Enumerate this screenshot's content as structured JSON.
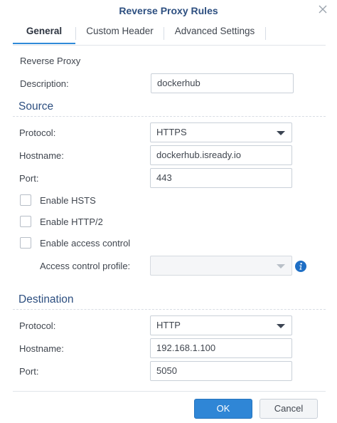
{
  "dialog": {
    "title": "Reverse Proxy Rules"
  },
  "tabs": [
    {
      "label": "General",
      "active": true
    },
    {
      "label": "Custom Header",
      "active": false
    },
    {
      "label": "Advanced Settings",
      "active": false
    }
  ],
  "general": {
    "heading": "Reverse Proxy",
    "description_label": "Description:",
    "description_value": "dockerhub"
  },
  "source": {
    "title": "Source",
    "protocol_label": "Protocol:",
    "protocol_value": "HTTPS",
    "hostname_label": "Hostname:",
    "hostname_value": "dockerhub.isready.io",
    "port_label": "Port:",
    "port_value": "443",
    "hsts_label": "Enable HSTS",
    "hsts_checked": false,
    "http2_label": "Enable HTTP/2",
    "http2_checked": false,
    "access_control_label": "Enable access control",
    "access_control_checked": false,
    "access_profile_label": "Access control profile:",
    "access_profile_value": ""
  },
  "destination": {
    "title": "Destination",
    "protocol_label": "Protocol:",
    "protocol_value": "HTTP",
    "hostname_label": "Hostname:",
    "hostname_value": "192.168.1.100",
    "port_label": "Port:",
    "port_value": "5050"
  },
  "buttons": {
    "ok": "OK",
    "cancel": "Cancel"
  },
  "colors": {
    "accent": "#2f86d6",
    "title": "#2d4f80",
    "info_icon": "#1f6fc5"
  },
  "icons": {
    "close": "close-icon",
    "info": "info-icon",
    "dropdown": "chevron-down-icon"
  }
}
